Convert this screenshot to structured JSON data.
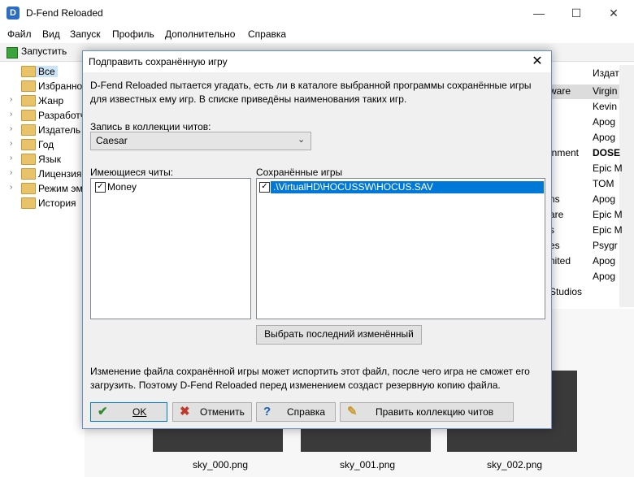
{
  "window": {
    "app_icon_glyph": "D",
    "title": "D-Fend Reloaded",
    "controls": {
      "minimize": "—",
      "maximize": "☐",
      "close": "✕"
    }
  },
  "menu": [
    "Файл",
    "Вид",
    "Запуск",
    "Профиль",
    "Дополнительно",
    "Справка"
  ],
  "toolbar": {
    "launch_label": "Запустить"
  },
  "tree": {
    "items": [
      {
        "label": "Все",
        "expander": ""
      },
      {
        "label": "Избранное",
        "expander": ""
      },
      {
        "label": "Жанр",
        "expander": "›"
      },
      {
        "label": "Разработчик",
        "expander": "›"
      },
      {
        "label": "Издатель",
        "expander": "›"
      },
      {
        "label": "Год",
        "expander": "›"
      },
      {
        "label": "Язык",
        "expander": "›"
      },
      {
        "label": "Лицензия",
        "expander": "›"
      },
      {
        "label": "Режим эмуляции",
        "expander": "›"
      },
      {
        "label": "История",
        "expander": ""
      }
    ]
  },
  "game_list": {
    "publisher_header": "Издатель",
    "developer_fragments": [
      "ware",
      "",
      "",
      "inment",
      "",
      "",
      "ns",
      "are",
      "s",
      "es",
      "nited",
      "",
      "Studios"
    ],
    "publishers": [
      "Virgin",
      "Kevin",
      "Apog",
      "Apog",
      "DOSE",
      "Epic M",
      "TOM",
      "Apog",
      "Epic M",
      "Epic M",
      "Psygr",
      "Apog",
      "Apog"
    ]
  },
  "thumbnails": [
    "sky_000.png",
    "sky_001.png",
    "sky_002.png"
  ],
  "dialog": {
    "title": "Подправить сохранённую игру",
    "close_glyph": "✕",
    "description": "D-Fend Reloaded пытается угадать, есть ли в каталоге выбранной программы сохранённые игры для известных ему игр. В списке приведёны наименования таких игр.",
    "cheat_record_label": "Запись в коллекции читов:",
    "cheat_record_value": "Caesar",
    "available_cheats_label": "Имеющиеся читы:",
    "available_cheats": [
      {
        "label": "Money",
        "checked": true
      }
    ],
    "saved_games_label": "Сохранённые игры",
    "saved_games": [
      {
        "label": ".\\VirtualHD\\HOCUSSW\\HOCUS.SAV",
        "checked": true,
        "selected": true
      }
    ],
    "select_last_modified_label": "Выбрать последний изменённый",
    "warning": "Изменение файла сохранённой игры может испортить этот файл, после чего игра не сможет его загрузить. Поэтому D-Fend Reloaded перед изменением создаст резервную копию файла.",
    "buttons": {
      "ok": "OK",
      "cancel": "Отменить",
      "help": "Справка",
      "edit_cheats": "Править коллекцию читов"
    },
    "colors": {
      "selection": "#0078d7",
      "ok_icon": "#2e8b2e",
      "cancel_icon": "#c0392b",
      "help_icon": "#1d5fb8"
    }
  }
}
